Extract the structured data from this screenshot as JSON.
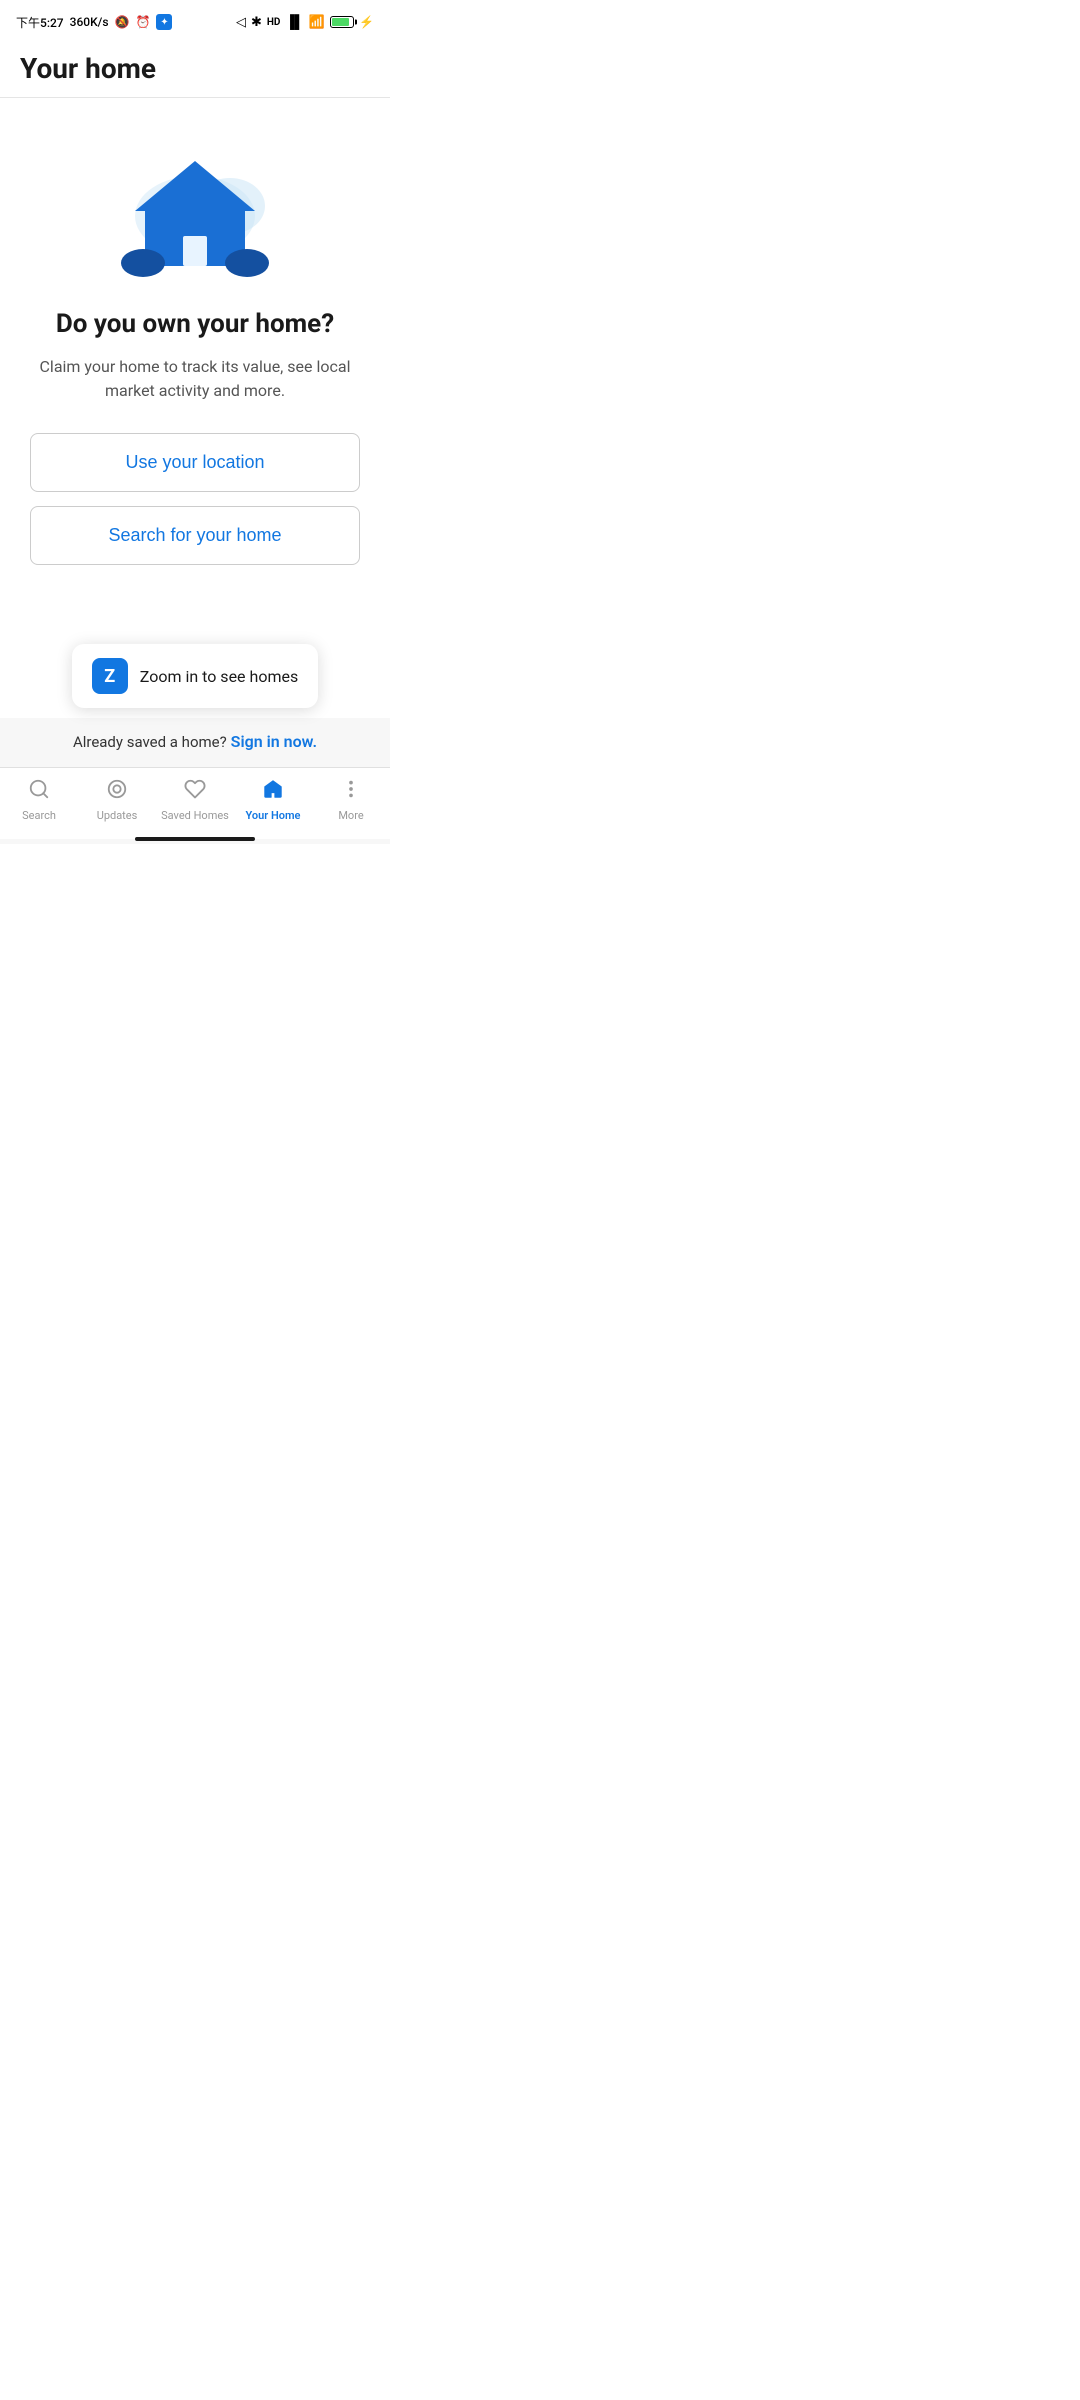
{
  "statusBar": {
    "time": "下午5:27",
    "network": "360K/s",
    "batteryLevel": 87
  },
  "header": {
    "title": "Your home"
  },
  "main": {
    "heading": "Do you own your home?",
    "subtext": "Claim your home to track its value, see local market activity and more.",
    "useLocationBtn": "Use your location",
    "searchHomeBtn": "Search for your home"
  },
  "zoomToast": {
    "text": "Zoom in to see homes"
  },
  "signinBar": {
    "preText": "Already saved a home?",
    "linkText": " Sign in now."
  },
  "bottomNav": {
    "items": [
      {
        "id": "search",
        "label": "Search",
        "active": false
      },
      {
        "id": "updates",
        "label": "Updates",
        "active": false
      },
      {
        "id": "saved-homes",
        "label": "Saved Homes",
        "active": false
      },
      {
        "id": "your-home",
        "label": "Your Home",
        "active": true
      },
      {
        "id": "more",
        "label": "More",
        "active": false
      }
    ]
  },
  "colors": {
    "primary": "#1277e1",
    "activeNav": "#1277e1",
    "inactiveNav": "#999999"
  }
}
